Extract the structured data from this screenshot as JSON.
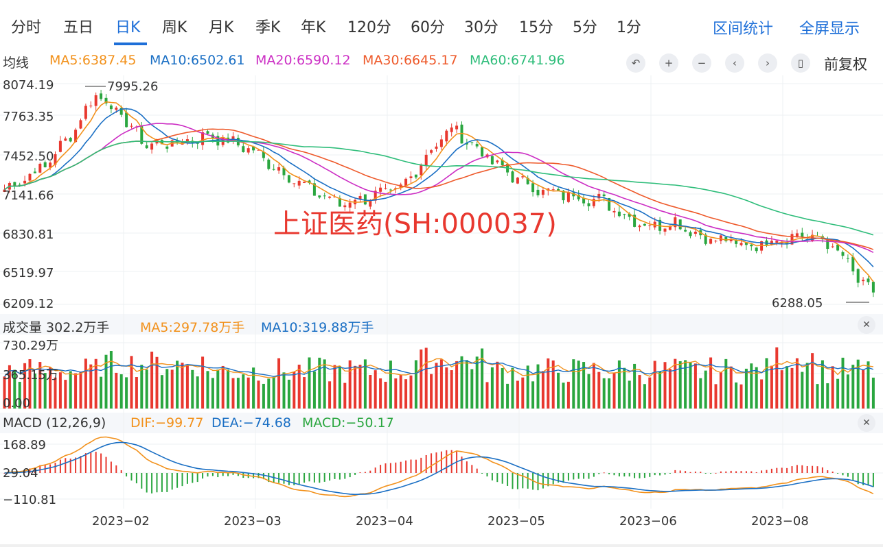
{
  "tabs": [
    {
      "label": "分时",
      "active": false
    },
    {
      "label": "五日",
      "active": false
    },
    {
      "label": "日K",
      "active": true
    },
    {
      "label": "周K",
      "active": false
    },
    {
      "label": "月K",
      "active": false
    },
    {
      "label": "季K",
      "active": false
    },
    {
      "label": "年K",
      "active": false
    },
    {
      "label": "120分",
      "active": false
    },
    {
      "label": "60分",
      "active": false
    },
    {
      "label": "30分",
      "active": false
    },
    {
      "label": "15分",
      "active": false
    },
    {
      "label": "5分",
      "active": false
    },
    {
      "label": "1分",
      "active": false
    }
  ],
  "actions": {
    "interval_stats": "区间统计",
    "fullscreen": "全屏显示"
  },
  "ma_legend": {
    "title": "均线",
    "items": [
      {
        "text": "MA5:6387.45",
        "color": "#f2911b"
      },
      {
        "text": "MA10:6502.61",
        "color": "#1a6fc4"
      },
      {
        "text": "MA20:6590.12",
        "color": "#cc2ec4"
      },
      {
        "text": "MA30:6645.17",
        "color": "#ee5a2b"
      },
      {
        "text": "MA60:6741.96",
        "color": "#2ebd7a"
      }
    ]
  },
  "toolbar": {
    "icons": [
      "undo-icon",
      "zoom-in-icon",
      "zoom-out-icon",
      "chevron-left-icon",
      "chevron-right-icon",
      "candlestick-icon"
    ],
    "adjust_label": "前复权"
  },
  "colors": {
    "up": "#e8382f",
    "down": "#2aa63f",
    "accent": "#1e6fd8"
  },
  "price_panel": {
    "y_labels": [
      "8074.19",
      "7763.35",
      "7452.50",
      "7141.66",
      "6830.81",
      "6519.97",
      "6209.12"
    ],
    "max_annotation": "7995.26",
    "min_annotation": "6288.05",
    "watermark": "上证医药(SH:000037)"
  },
  "volume_panel": {
    "label": "成交量 302.2万手",
    "ma5": "MA5:297.78万手",
    "ma10": "MA10:319.88万手",
    "y_labels": [
      "730.29万",
      "365.15万",
      "0.00"
    ]
  },
  "macd_panel": {
    "label": "MACD (12,26,9)",
    "dif": "DIF:−99.77",
    "dea": "DEA:−74.68",
    "macd": "MACD:−50.17",
    "y_labels": [
      "168.89",
      "29.04",
      "−110.81"
    ]
  },
  "x_axis": [
    "2023−02",
    "2023−03",
    "2023−04",
    "2023−05",
    "2023−06",
    "2023−08"
  ],
  "chart_data": {
    "type": "candlestick",
    "y_range": [
      6209.12,
      8074.19
    ],
    "days": 150,
    "series": [
      {
        "name": "MA5",
        "last": 6387.45
      },
      {
        "name": "MA10",
        "last": 6502.61
      },
      {
        "name": "MA20",
        "last": 6590.12
      },
      {
        "name": "MA30",
        "last": 6645.17
      },
      {
        "name": "MA60",
        "last": 6741.96
      }
    ],
    "price_anchors": [
      [
        0,
        7180
      ],
      [
        8,
        7380
      ],
      [
        14,
        7700
      ],
      [
        18,
        7995
      ],
      [
        22,
        7840
      ],
      [
        28,
        7560
      ],
      [
        35,
        7580
      ],
      [
        40,
        7640
      ],
      [
        48,
        7530
      ],
      [
        55,
        7320
      ],
      [
        60,
        7180
      ],
      [
        66,
        7060
      ],
      [
        72,
        7120
      ],
      [
        78,
        7180
      ],
      [
        84,
        7520
      ],
      [
        88,
        7700
      ],
      [
        92,
        7560
      ],
      [
        97,
        7380
      ],
      [
        102,
        7240
      ],
      [
        107,
        7150
      ],
      [
        112,
        7130
      ],
      [
        118,
        7080
      ],
      [
        122,
        6960
      ],
      [
        127,
        6870
      ],
      [
        132,
        6910
      ],
      [
        137,
        6780
      ],
      [
        142,
        6740
      ],
      [
        147,
        6700
      ],
      [
        151,
        6760
      ],
      [
        156,
        6790
      ],
      [
        160,
        6770
      ],
      [
        164,
        6660
      ],
      [
        168,
        6420
      ],
      [
        171,
        6300
      ]
    ]
  }
}
